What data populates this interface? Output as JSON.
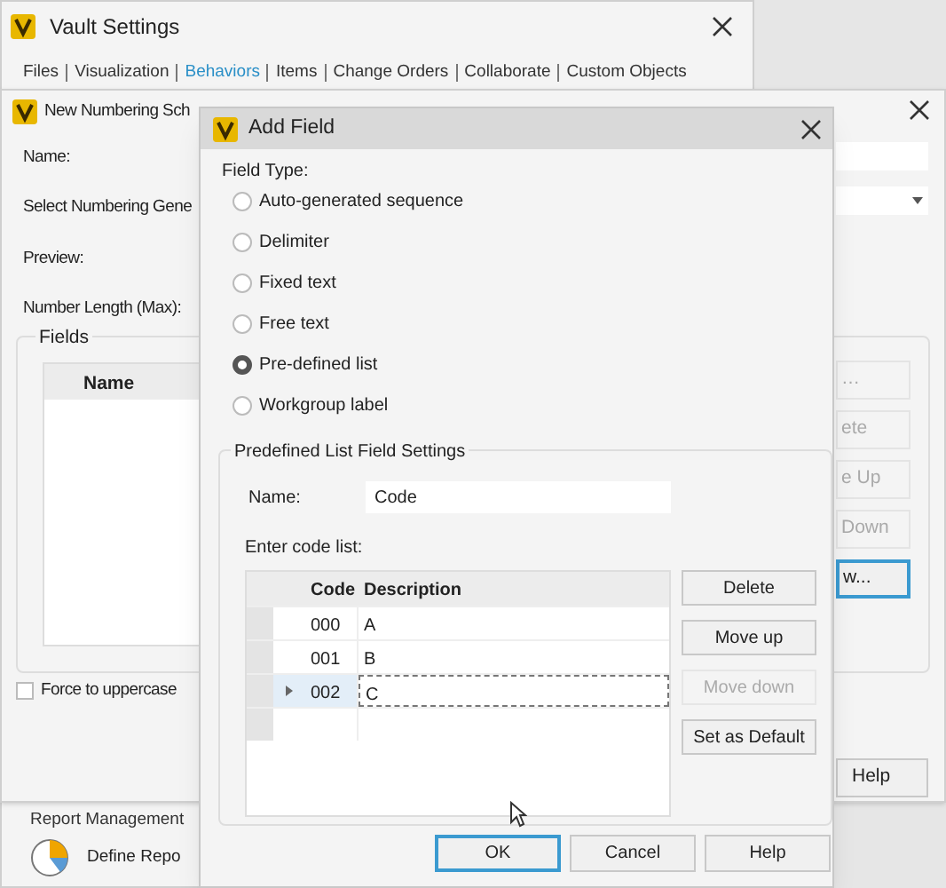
{
  "vault_settings": {
    "title": "Vault Settings",
    "tabs": [
      {
        "label": "Files",
        "selected": false
      },
      {
        "label": "Visualization",
        "selected": false
      },
      {
        "label": "Behaviors",
        "selected": true
      },
      {
        "label": "Items",
        "selected": false
      },
      {
        "label": "Change Orders",
        "selected": false
      },
      {
        "label": "Collaborate",
        "selected": false
      },
      {
        "label": "Custom Objects",
        "selected": false
      }
    ],
    "report_heading": "Report Management",
    "report_item": "Define Repo"
  },
  "numbering_scheme": {
    "title": "New Numbering Sch",
    "labels": [
      "Name:",
      "Select Numbering Gene",
      "Preview:",
      "Number Length (Max):"
    ],
    "fields_group": {
      "title": "Fields",
      "columns": [
        "Name"
      ]
    },
    "force_uppercase": {
      "label": "Force to uppercase",
      "checked": false
    },
    "side_buttons": [
      {
        "label": "…",
        "disabled": true,
        "focused": false
      },
      {
        "label": "ete",
        "disabled": true,
        "focused": false
      },
      {
        "label": "e Up",
        "disabled": true,
        "focused": false
      },
      {
        "label": "Down",
        "disabled": true,
        "focused": false
      },
      {
        "label": "w...",
        "disabled": false,
        "focused": true
      }
    ],
    "help_button": "Help"
  },
  "add_field": {
    "title": "Add Field",
    "field_type_label": "Field Type:",
    "options": [
      {
        "label": "Auto-generated sequence",
        "selected": false
      },
      {
        "label": "Delimiter",
        "selected": false
      },
      {
        "label": "Fixed text",
        "selected": false
      },
      {
        "label": "Free text",
        "selected": false
      },
      {
        "label": "Pre-defined list",
        "selected": true
      },
      {
        "label": "Workgroup label",
        "selected": false
      }
    ],
    "settings": {
      "title": "Predefined List Field Settings",
      "name_label": "Name:",
      "name_value": "Code",
      "list_label": "Enter code list:",
      "columns": [
        "Code",
        "Description"
      ],
      "rows": [
        {
          "code": "000",
          "description": "A",
          "current": false
        },
        {
          "code": "001",
          "description": "B",
          "current": false
        },
        {
          "code": "002",
          "description": "C",
          "current": true
        }
      ],
      "buttons": [
        {
          "label": "Delete",
          "disabled": false
        },
        {
          "label": "Move up",
          "disabled": false
        },
        {
          "label": "Move down",
          "disabled": true
        },
        {
          "label": "Set as Default",
          "disabled": false
        }
      ]
    },
    "footer_buttons": [
      {
        "label": "OK",
        "default": true
      },
      {
        "label": "Cancel",
        "default": false
      },
      {
        "label": "Help",
        "default": false
      }
    ]
  }
}
